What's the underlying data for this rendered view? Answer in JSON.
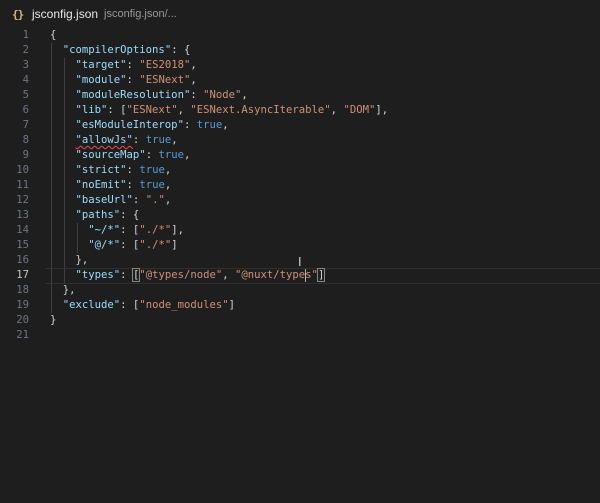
{
  "tab": {
    "icon": "{}",
    "title": "jsconfig.json",
    "breadcrumb": "jsconfig.json/..."
  },
  "editor": {
    "active_line": 17,
    "lines": [
      {
        "n": "1",
        "tokens": [
          {
            "t": "p",
            "v": "{"
          }
        ]
      },
      {
        "n": "2",
        "tokens": [
          {
            "t": "p",
            "v": "  "
          },
          {
            "t": "k",
            "v": "\"compilerOptions\""
          },
          {
            "t": "p",
            "v": ": {"
          }
        ]
      },
      {
        "n": "3",
        "tokens": [
          {
            "t": "p",
            "v": "    "
          },
          {
            "t": "k",
            "v": "\"target\""
          },
          {
            "t": "p",
            "v": ": "
          },
          {
            "t": "s",
            "v": "\"ES2018\""
          },
          {
            "t": "p",
            "v": ","
          }
        ]
      },
      {
        "n": "4",
        "tokens": [
          {
            "t": "p",
            "v": "    "
          },
          {
            "t": "k",
            "v": "\"module\""
          },
          {
            "t": "p",
            "v": ": "
          },
          {
            "t": "s",
            "v": "\"ESNext\""
          },
          {
            "t": "p",
            "v": ","
          }
        ]
      },
      {
        "n": "5",
        "tokens": [
          {
            "t": "p",
            "v": "    "
          },
          {
            "t": "k",
            "v": "\"moduleResolution\""
          },
          {
            "t": "p",
            "v": ": "
          },
          {
            "t": "s",
            "v": "\"Node\""
          },
          {
            "t": "p",
            "v": ","
          }
        ]
      },
      {
        "n": "6",
        "tokens": [
          {
            "t": "p",
            "v": "    "
          },
          {
            "t": "k",
            "v": "\"lib\""
          },
          {
            "t": "p",
            "v": ": ["
          },
          {
            "t": "s",
            "v": "\"ESNext\""
          },
          {
            "t": "p",
            "v": ", "
          },
          {
            "t": "s",
            "v": "\"ESNext.AsyncIterable\""
          },
          {
            "t": "p",
            "v": ", "
          },
          {
            "t": "s",
            "v": "\"DOM\""
          },
          {
            "t": "p",
            "v": "],"
          }
        ]
      },
      {
        "n": "7",
        "tokens": [
          {
            "t": "p",
            "v": "    "
          },
          {
            "t": "k",
            "v": "\"esModuleInterop\""
          },
          {
            "t": "p",
            "v": ": "
          },
          {
            "t": "b",
            "v": "true"
          },
          {
            "t": "p",
            "v": ","
          }
        ]
      },
      {
        "n": "8",
        "tokens": [
          {
            "t": "p",
            "v": "    "
          },
          {
            "t": "k",
            "v": "\"allowJs\"",
            "squiggle": true
          },
          {
            "t": "p",
            "v": ": "
          },
          {
            "t": "b",
            "v": "true"
          },
          {
            "t": "p",
            "v": ","
          }
        ]
      },
      {
        "n": "9",
        "tokens": [
          {
            "t": "p",
            "v": "    "
          },
          {
            "t": "k",
            "v": "\"sourceMap\""
          },
          {
            "t": "p",
            "v": ": "
          },
          {
            "t": "b",
            "v": "true"
          },
          {
            "t": "p",
            "v": ","
          }
        ]
      },
      {
        "n": "10",
        "tokens": [
          {
            "t": "p",
            "v": "    "
          },
          {
            "t": "k",
            "v": "\"strict\""
          },
          {
            "t": "p",
            "v": ": "
          },
          {
            "t": "b",
            "v": "true"
          },
          {
            "t": "p",
            "v": ","
          }
        ]
      },
      {
        "n": "11",
        "tokens": [
          {
            "t": "p",
            "v": "    "
          },
          {
            "t": "k",
            "v": "\"noEmit\""
          },
          {
            "t": "p",
            "v": ": "
          },
          {
            "t": "b",
            "v": "true"
          },
          {
            "t": "p",
            "v": ","
          }
        ]
      },
      {
        "n": "12",
        "tokens": [
          {
            "t": "p",
            "v": "    "
          },
          {
            "t": "k",
            "v": "\"baseUrl\""
          },
          {
            "t": "p",
            "v": ": "
          },
          {
            "t": "s",
            "v": "\".\""
          },
          {
            "t": "p",
            "v": ","
          }
        ]
      },
      {
        "n": "13",
        "tokens": [
          {
            "t": "p",
            "v": "    "
          },
          {
            "t": "k",
            "v": "\"paths\""
          },
          {
            "t": "p",
            "v": ": {"
          }
        ]
      },
      {
        "n": "14",
        "tokens": [
          {
            "t": "p",
            "v": "      "
          },
          {
            "t": "k",
            "v": "\"~/*\""
          },
          {
            "t": "p",
            "v": ": ["
          },
          {
            "t": "s",
            "v": "\"./*\""
          },
          {
            "t": "p",
            "v": "],"
          }
        ]
      },
      {
        "n": "15",
        "tokens": [
          {
            "t": "p",
            "v": "      "
          },
          {
            "t": "k",
            "v": "\"@/*\""
          },
          {
            "t": "p",
            "v": ": ["
          },
          {
            "t": "s",
            "v": "\"./*\""
          },
          {
            "t": "p",
            "v": "]"
          }
        ]
      },
      {
        "n": "16",
        "tokens": [
          {
            "t": "p",
            "v": "    },"
          }
        ]
      },
      {
        "n": "17",
        "tokens": [
          {
            "t": "p",
            "v": "    "
          },
          {
            "t": "k",
            "v": "\"types\""
          },
          {
            "t": "p",
            "v": ": "
          },
          {
            "t": "p",
            "v": "[",
            "box": true
          },
          {
            "t": "s",
            "v": "\"@types/node\""
          },
          {
            "t": "p",
            "v": ", "
          },
          {
            "t": "s",
            "v": "\"@nuxt/types\""
          },
          {
            "t": "p",
            "v": "]",
            "box": true
          }
        ]
      },
      {
        "n": "18",
        "tokens": [
          {
            "t": "p",
            "v": "  },"
          }
        ]
      },
      {
        "n": "19",
        "tokens": [
          {
            "t": "p",
            "v": "  "
          },
          {
            "t": "k",
            "v": "\"exclude\""
          },
          {
            "t": "p",
            "v": ": ["
          },
          {
            "t": "s",
            "v": "\"node_modules\""
          },
          {
            "t": "p",
            "v": "]"
          }
        ]
      },
      {
        "n": "20",
        "tokens": [
          {
            "t": "p",
            "v": "}"
          }
        ]
      },
      {
        "n": "21",
        "tokens": []
      }
    ]
  }
}
